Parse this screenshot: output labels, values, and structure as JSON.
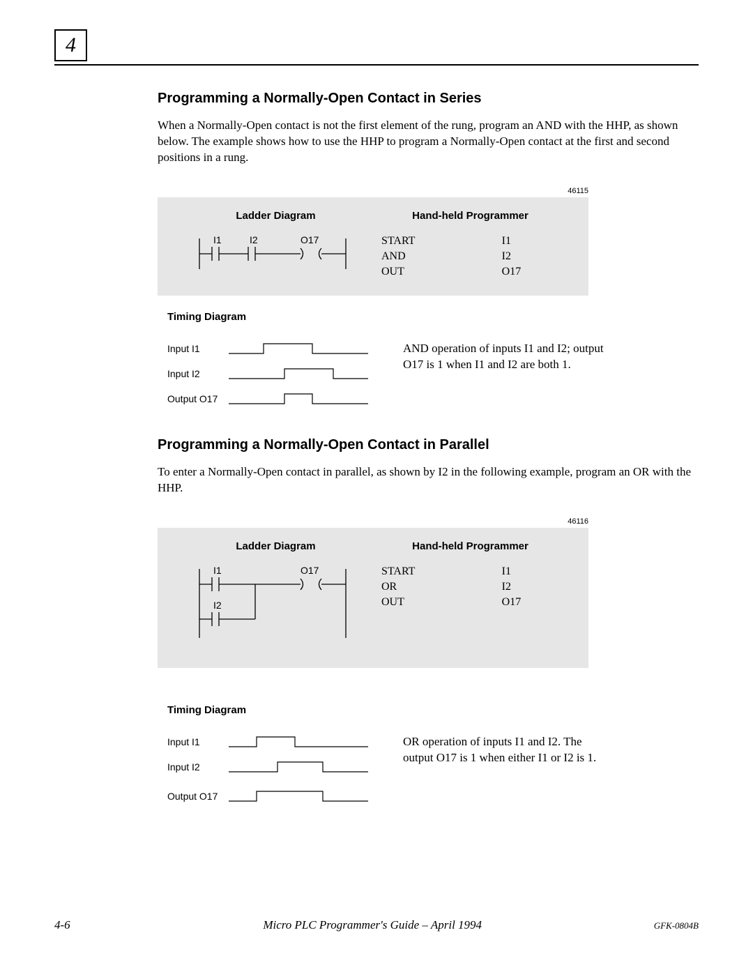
{
  "chapter": "4",
  "section1": {
    "title": "Programming  a  Normally-Open Contact in Series",
    "paragraph": "When a Normally-Open contact is not the first element of the rung, program an AND with the HHP, as shown below. The example shows how to use the HHP to program a Normally-Open contact at the first and second positions in a rung.",
    "figureId": "46115",
    "ladderHeader": "Ladder Diagram",
    "hhpHeader": "Hand-held Programmer",
    "ladderLabels": {
      "i1": "I1",
      "i2": "I2",
      "out": "O17"
    },
    "hhp": [
      {
        "cmd": "START",
        "arg": "I1"
      },
      {
        "cmd": "AND",
        "arg": "I2"
      },
      {
        "cmd": "OUT",
        "arg": "O17"
      }
    ],
    "timingHeader": "Timing Diagram",
    "timing": {
      "rows": [
        "Input I1",
        "Input I2",
        "Output O17"
      ],
      "explain": "AND operation of inputs I1 and I2; output O17 is 1 when I1 and I2 are both 1."
    }
  },
  "section2": {
    "title": "Programming  a  Normally-Open Contact in Parallel",
    "paragraph": "To enter a Normally-Open contact in parallel, as shown by I2 in the following example, program an OR  with the HHP.",
    "figureId": "46116",
    "ladderHeader": "Ladder Diagram",
    "hhpHeader": "Hand-held Programmer",
    "ladderLabels": {
      "i1": "I1",
      "i2": "I2",
      "out": "O17"
    },
    "hhp": [
      {
        "cmd": "START",
        "arg": "I1"
      },
      {
        "cmd": "OR",
        "arg": "I2"
      },
      {
        "cmd": "OUT",
        "arg": "O17"
      }
    ],
    "timingHeader": "Timing Diagram",
    "timing": {
      "rows": [
        "Input I1",
        "Input I2",
        "Output O17"
      ],
      "explain": "OR operation of inputs I1 and I2. The output O17 is 1 when either I1 or I2 is 1."
    }
  },
  "footer": {
    "pageNum": "4-6",
    "bookTitle": "Micro PLC Programmer's Guide – April 1994",
    "docId": "GFK-0804B"
  }
}
